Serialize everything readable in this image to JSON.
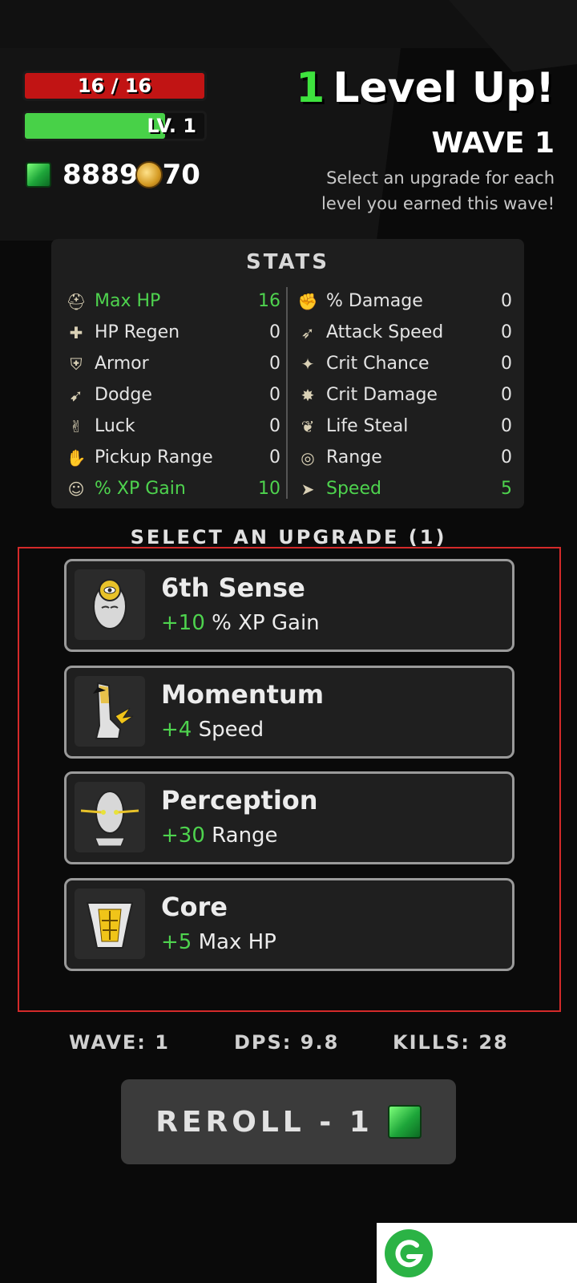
{
  "hud": {
    "hp_text": "16 / 16",
    "level_text": "LV. 1",
    "level_progress": 0.78,
    "currency_text": "8889",
    "currency_text_2": "70"
  },
  "header": {
    "levelup_count": "1",
    "levelup_label": "Level Up!",
    "wave_title": "WAVE 1",
    "instruction": "Select an upgrade for each level you earned this wave!"
  },
  "stats": {
    "title": "STATS",
    "left": [
      {
        "icon": "helmet-icon",
        "label": "Max HP",
        "value": "16",
        "highlight": true
      },
      {
        "icon": "regen-icon",
        "label": "HP Regen",
        "value": "0",
        "highlight": false
      },
      {
        "icon": "armor-icon",
        "label": "Armor",
        "value": "0",
        "highlight": false
      },
      {
        "icon": "dodge-icon",
        "label": "Dodge",
        "value": "0",
        "highlight": false
      },
      {
        "icon": "luck-icon",
        "label": "Luck",
        "value": "0",
        "highlight": false
      },
      {
        "icon": "pickup-icon",
        "label": "Pickup Range",
        "value": "0",
        "highlight": false
      },
      {
        "icon": "xp-icon",
        "label": "% XP Gain",
        "value": "10",
        "highlight": true
      }
    ],
    "right": [
      {
        "icon": "muscle-icon",
        "label": "% Damage",
        "value": "0",
        "highlight": false
      },
      {
        "icon": "attack-speed-icon",
        "label": "Attack Speed",
        "value": "0",
        "highlight": false
      },
      {
        "icon": "crit-chance-icon",
        "label": "Crit Chance",
        "value": "0",
        "highlight": false
      },
      {
        "icon": "crit-damage-icon",
        "label": "Crit Damage",
        "value": "0",
        "highlight": false
      },
      {
        "icon": "life-steal-icon",
        "label": "Life Steal",
        "value": "0",
        "highlight": false
      },
      {
        "icon": "range-icon",
        "label": "Range",
        "value": "0",
        "highlight": false
      },
      {
        "icon": "speed-icon",
        "label": "Speed",
        "value": "5",
        "highlight": true
      }
    ]
  },
  "upgrade_section": {
    "title": "SELECT AN UPGRADE (1)"
  },
  "upgrades": [
    {
      "icon": "third-eye-head-icon",
      "name": "6th Sense",
      "amount": "+10",
      "stat": " % XP Gain"
    },
    {
      "icon": "winged-leg-icon",
      "name": "Momentum",
      "amount": "+4",
      "stat": " Speed"
    },
    {
      "icon": "glowing-eyes-head-icon",
      "name": "Perception",
      "amount": "+30",
      "stat": " Range"
    },
    {
      "icon": "torso-icon",
      "name": "Core",
      "amount": "+5",
      "stat": " Max HP"
    }
  ],
  "footer": {
    "wave": "WAVE: 1",
    "dps": "DPS: 9.8",
    "kills": "KILLS: 28"
  },
  "reroll": {
    "label": "REROLL - 1"
  },
  "colors": {
    "accent_green": "#4ed34e",
    "hp_red": "#c11414",
    "highlight_border": "#d42a2a"
  }
}
